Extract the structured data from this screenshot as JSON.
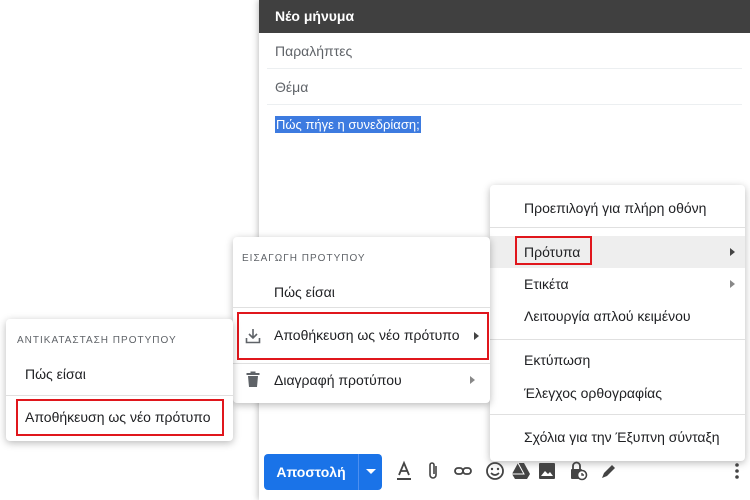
{
  "compose": {
    "title": "Νέο μήνυμα",
    "to_placeholder": "Παραλήπτες",
    "subject_placeholder": "Θέμα",
    "body_text": "Πώς πήγε η συνεδρίαση;",
    "send_label": "Αποστολή"
  },
  "more_menu": {
    "items": [
      {
        "label": "Προεπιλογή για πλήρη οθόνη"
      },
      {
        "label": "Πρότυπα"
      },
      {
        "label": "Ετικέτα"
      },
      {
        "label": "Λειτουργία απλού κειμένου"
      },
      {
        "label": "Εκτύπωση"
      },
      {
        "label": "Έλεγχος ορθογραφίας"
      },
      {
        "label": "Σχόλια για την Έξυπνη σύνταξη"
      }
    ]
  },
  "templates_menu": {
    "header": "ΕΙΣΑΓΩΓΗ ΠΡΟΤΥΠΟΥ",
    "items": [
      {
        "label": "Πώς είσαι"
      },
      {
        "label": "Αποθήκευση ως νέο πρότυπο"
      },
      {
        "label": "Διαγραφή προτύπου"
      }
    ]
  },
  "replace_menu": {
    "header": "ΑΝΤΙΚΑΤΑΣΤΑΣΗ ΠΡΟΤΥΠΟΥ",
    "items": [
      {
        "label": "Πώς είσαι"
      },
      {
        "label": "Αποθήκευση ως νέο πρότυπο"
      }
    ]
  },
  "colors": {
    "accent": "#1a73e8",
    "highlight": "#e0161c",
    "header_bg": "#404040",
    "selection": "#3d7be0"
  },
  "toolbar_icons": [
    "format-text-icon",
    "attach-icon",
    "link-icon",
    "emoji-icon",
    "drive-icon",
    "photo-icon",
    "confidential-icon",
    "signature-icon",
    "more-options-icon"
  ]
}
